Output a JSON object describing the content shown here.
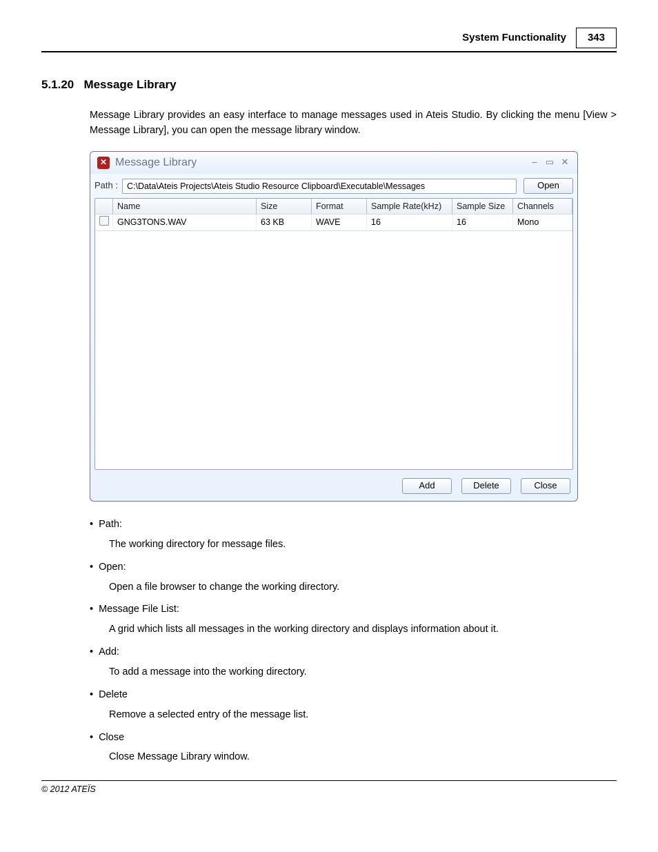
{
  "page_header": {
    "title": "System Functionality",
    "page": "343"
  },
  "section": {
    "number": "5.1.20",
    "title": "Message Library"
  },
  "intro": "Message Library provides an easy interface to manage messages used in Ateis Studio. By clicking the menu [View > Message Library], you can open the message library window.",
  "window": {
    "title": "Message Library",
    "path_label": "Path :",
    "path_value": "C:\\Data\\Ateis Projects\\Ateis Studio Resource Clipboard\\Executable\\Messages",
    "open_btn": "Open",
    "columns": {
      "name": "Name",
      "size": "Size",
      "format": "Format",
      "rate": "Sample Rate(kHz)",
      "ssize": "Sample Size",
      "ch": "Channels"
    },
    "row": {
      "name": "GNG3TONS.WAV",
      "size": "63 KB",
      "format": "WAVE",
      "rate": "16",
      "ssize": "16",
      "ch": "Mono"
    },
    "buttons": {
      "add": "Add",
      "delete": "Delete",
      "close": "Close"
    }
  },
  "definitions": [
    {
      "term": "Path:",
      "desc": "The working directory for message files."
    },
    {
      "term": "Open:",
      "desc": "Open a file browser to change the working directory."
    },
    {
      "term": "Message File List:",
      "desc": "A grid which lists all messages in the working directory and displays information about it."
    },
    {
      "term": "Add:",
      "desc": "To add a message into the working directory."
    },
    {
      "term": "Delete",
      "desc": "Remove a selected entry of the message list."
    },
    {
      "term": "Close",
      "desc": "Close Message Library window."
    }
  ],
  "footer": "© 2012 ATEÏS"
}
